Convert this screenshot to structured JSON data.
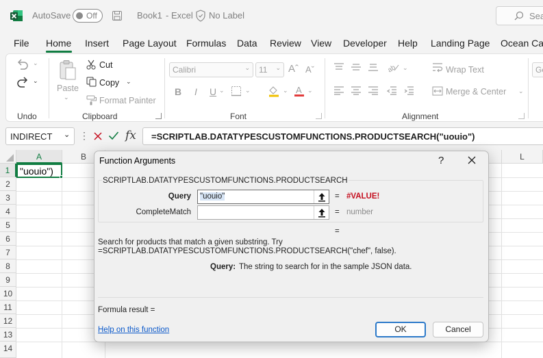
{
  "titlebar": {
    "autosave_label": "AutoSave",
    "autosave_state": "Off",
    "book_title": "Book1",
    "separator": "-",
    "app_name": "Excel",
    "label_status": "No Label",
    "search_placeholder": "Sea"
  },
  "tabs": [
    "File",
    "Home",
    "Insert",
    "Page Layout",
    "Formulas",
    "Data",
    "Review",
    "View",
    "Developer",
    "Help",
    "Landing Page",
    "Ocean Cam"
  ],
  "active_tab": "Home",
  "ribbon": {
    "undo": {
      "group_label": "Undo"
    },
    "clipboard": {
      "group_label": "Clipboard",
      "paste": "Paste",
      "cut": "Cut",
      "copy": "Copy",
      "format_painter": "Format Painter"
    },
    "font": {
      "group_label": "Font",
      "font_name": "Calibri",
      "font_size": "11",
      "bold": "B",
      "italic": "I",
      "underline": "U"
    },
    "alignment": {
      "group_label": "Alignment",
      "wrap_text": "Wrap Text",
      "merge_center": "Merge & Center"
    },
    "number": {
      "format_partial": "Ge"
    }
  },
  "formula_bar": {
    "name_box": "INDIRECT",
    "fx_label": "fx",
    "formula": "=SCRIPTLAB.DATATYPESCUSTOMFUNCTIONS.PRODUCTSEARCH(\"uouio\")"
  },
  "grid": {
    "columns": [
      "A",
      "B",
      "L"
    ],
    "rows": [
      "1",
      "2",
      "3",
      "4",
      "5",
      "6",
      "7",
      "8",
      "9",
      "10",
      "11",
      "12",
      "13",
      "14"
    ],
    "cell_A1": "\"uouio\")"
  },
  "dialog": {
    "title": "Function Arguments",
    "help_glyph": "?",
    "function_name": "SCRIPTLAB.DATATYPESCUSTOMFUNCTIONS.PRODUCTSEARCH",
    "args": [
      {
        "label": "Query",
        "value": "\"uouio\"",
        "eq": "=",
        "result": "#VALUE!"
      },
      {
        "label": "CompleteMatch",
        "value": "",
        "eq": "=",
        "result": "number"
      }
    ],
    "total_eq": "=",
    "description_line1": "Search for products that match a given substring. Try",
    "description_line2": "=SCRIPTLAB.DATATYPESCUSTOMFUNCTIONS.PRODUCTSEARCH(\"chef\", false).",
    "param_name": "Query:",
    "param_desc": "The string to search for in the sample JSON data.",
    "formula_result_label": "Formula result =",
    "help_link": "Help on this function",
    "ok": "OK",
    "cancel": "Cancel"
  },
  "colors": {
    "accent": "#107c41",
    "error": "#c50f1f",
    "link": "#0a58ca"
  }
}
